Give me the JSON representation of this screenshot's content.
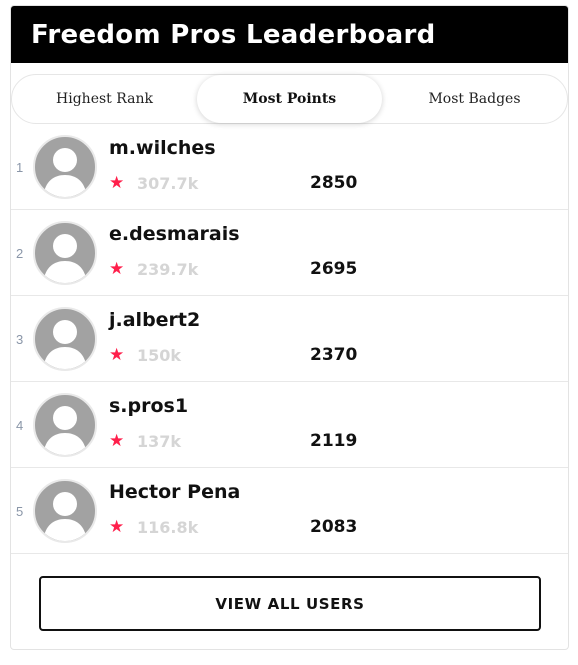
{
  "header": {
    "title": "Freedom Pros Leaderboard"
  },
  "tabs": [
    {
      "label": "Highest Rank",
      "active": false
    },
    {
      "label": "Most Points",
      "active": true
    },
    {
      "label": "Most Badges",
      "active": false
    }
  ],
  "users": [
    {
      "rank": "1",
      "name": "m.wilches",
      "points": "307.7k",
      "score": "2850"
    },
    {
      "rank": "2",
      "name": "e.desmarais",
      "points": "239.7k",
      "score": "2695"
    },
    {
      "rank": "3",
      "name": "j.albert2",
      "points": "150k",
      "score": "2370"
    },
    {
      "rank": "4",
      "name": "s.pros1",
      "points": "137k",
      "score": "2119"
    },
    {
      "rank": "5",
      "name": "Hector Pena",
      "points": "116.8k",
      "score": "2083"
    }
  ],
  "footer": {
    "view_all_label": "VIEW ALL USERS"
  },
  "colors": {
    "header_bg": "#000000",
    "star": "#ff1f4b",
    "faded_points": "#d5d5d5"
  },
  "icons": {
    "avatar": "default-user-avatar-icon",
    "star": "star-icon"
  }
}
